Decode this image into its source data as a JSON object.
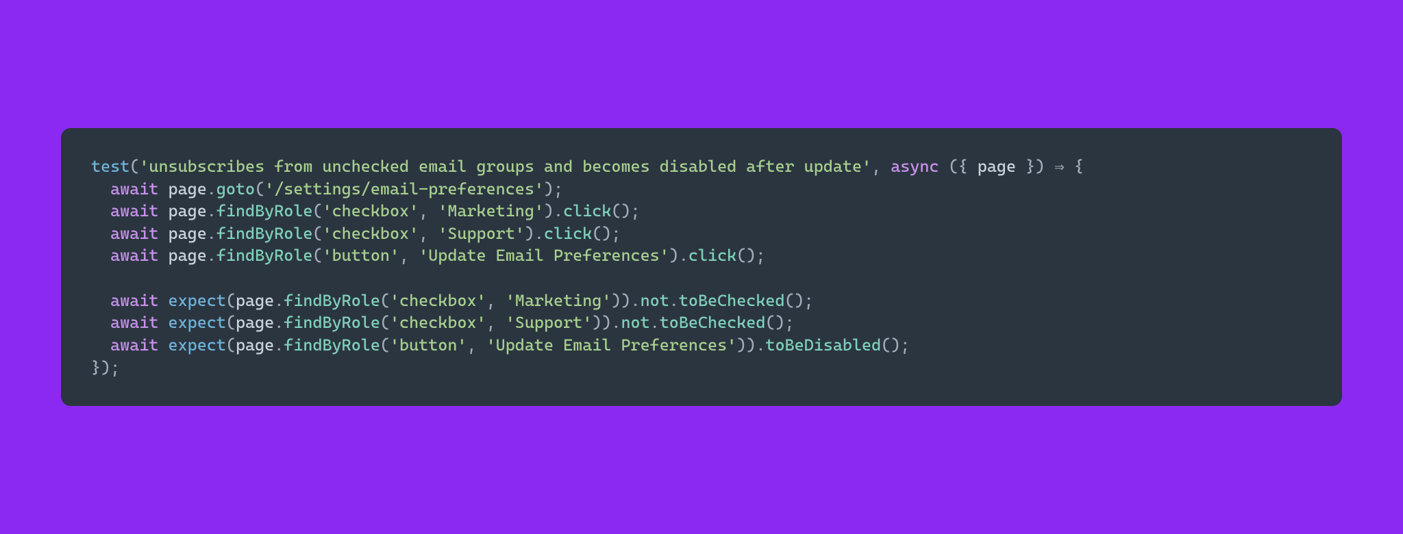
{
  "code": {
    "fn": "test",
    "desc": "'unsubscribes from unchecked email groups and becomes disabled after update'",
    "async": "async",
    "param": "page",
    "arrow": "⇒",
    "lines": {
      "l1": {
        "await": "await",
        "obj": "page",
        "meth": "goto",
        "arg": "'/settings/email-preferences'"
      },
      "l2": {
        "await": "await",
        "obj": "page",
        "meth": "findByRole",
        "a1": "'checkbox'",
        "a2": "'Marketing'",
        "chain": "click"
      },
      "l3": {
        "await": "await",
        "obj": "page",
        "meth": "findByRole",
        "a1": "'checkbox'",
        "a2": "'Support'",
        "chain": "click"
      },
      "l4": {
        "await": "await",
        "obj": "page",
        "meth": "findByRole",
        "a1": "'button'",
        "a2": "'Update Email Preferences'",
        "chain": "click"
      },
      "l5": {
        "await": "await",
        "exp": "expect",
        "obj": "page",
        "meth": "findByRole",
        "a1": "'checkbox'",
        "a2": "'Marketing'",
        "neg": "not",
        "asrt": "toBeChecked"
      },
      "l6": {
        "await": "await",
        "exp": "expect",
        "obj": "page",
        "meth": "findByRole",
        "a1": "'checkbox'",
        "a2": "'Support'",
        "neg": "not",
        "asrt": "toBeChecked"
      },
      "l7": {
        "await": "await",
        "exp": "expect",
        "obj": "page",
        "meth": "findByRole",
        "a1": "'button'",
        "a2": "'Update Email Preferences'",
        "asrt": "toBeDisabled"
      }
    }
  }
}
